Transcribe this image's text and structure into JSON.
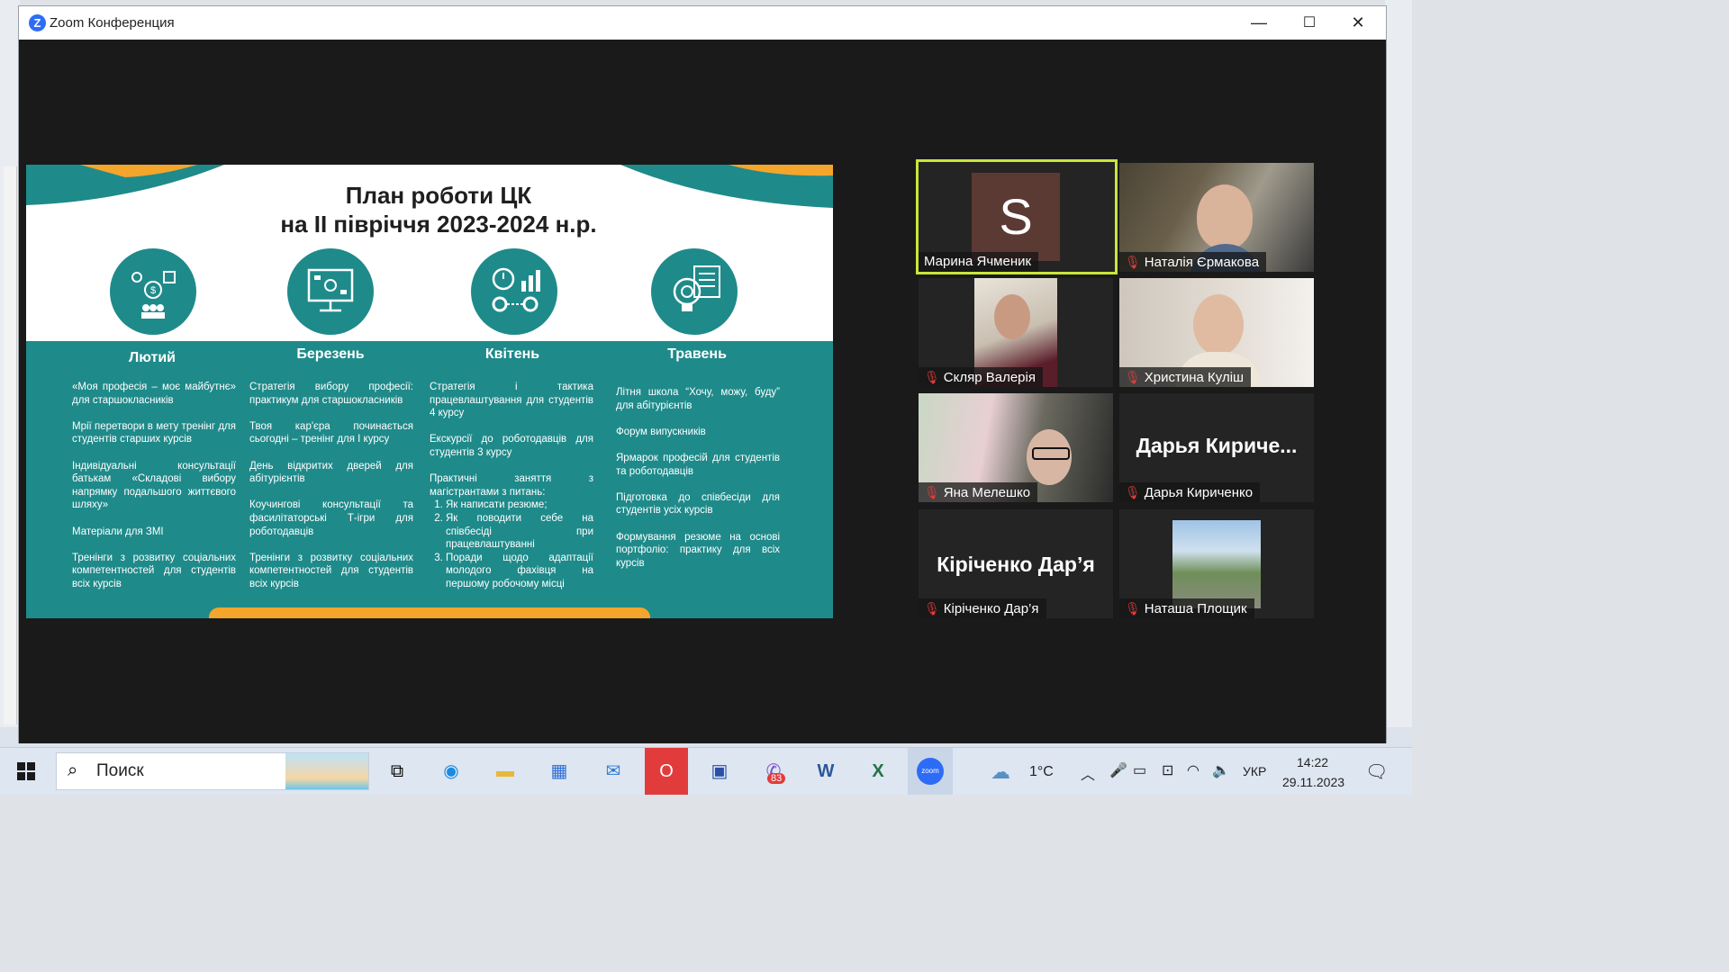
{
  "window": {
    "title": "Zoom Конференция",
    "minimize": "—",
    "maximize": "☐",
    "close": "✕"
  },
  "slide": {
    "title_line1": "План роботи ЦК",
    "title_line2": "на ІІ півріччя 2023-2024 н.р.",
    "columns": [
      {
        "month": "Лютий",
        "items": [
          "«Моя професія – моє майбутнє» для старшокласників",
          "Мрії перетвори в мету тренінг для студентів старших курсів",
          "Індивідуальні консультації батькам «Складові вибору напрямку подальшого життєвого шляху»",
          "Матеріали для ЗМІ",
          "Тренінги з розвитку соціальних компетентностей для студентів всіх курсів"
        ]
      },
      {
        "month": "Березень",
        "items": [
          "Стратегія вибору професії: практикум для старшокласників",
          "Твоя кар'єра починається сьогодні – тренінг для І курсу",
          "День відкритих дверей для абітурієнтів",
          "Коучингові консультації та фасилітаторські Т-ігри для роботодавців",
          "Тренінги з розвитку соціальних компетентностей для студентів всіх курсів"
        ]
      },
      {
        "month": "Квітень",
        "items": [
          "Стратегія і тактика працевлаштування для студентів 4 курсу",
          "Екскурсії до роботодавців для студентів 3 курсу",
          "Практичні заняття з магістрантами з питань:"
        ],
        "sublist": [
          "Як написати резюме;",
          "Як поводити себе на співбесіді при працевлаштуванні",
          "Поради щодо адаптації молодого фахівця на першому робочому місці"
        ]
      },
      {
        "month": "Травень",
        "items": [
          "Літня школа “Хочу, можу, буду” для абітурієнтів",
          "Форум випускників",
          "Ярмарок професій для студентів та роботодавців",
          "Підготовка до співбесіди для студентів усіх курсів",
          "Формування резюме на основі портфоліо: практику для всіх курсів"
        ]
      }
    ]
  },
  "participants": [
    {
      "name": "Марина Ячменик",
      "muted": false,
      "avatar_letter": "S"
    },
    {
      "name": "Наталія Єрмакова",
      "muted": true
    },
    {
      "name": "Скляр Валерія",
      "muted": true
    },
    {
      "name": "Христина Куліш",
      "muted": true
    },
    {
      "name": "Яна Мелешко",
      "muted": true
    },
    {
      "name": "Дарья Кириченко",
      "muted": true,
      "display_text": "Дарья Кириче..."
    },
    {
      "name": "Кіріченко Дар’я",
      "muted": true,
      "display_text": "Кіріченко Дар’я"
    },
    {
      "name": "Наташа Площик",
      "muted": true
    }
  ],
  "taskbar": {
    "search_placeholder": "Поиск",
    "weather": "1°C",
    "language": "УКР",
    "time": "14:22",
    "date": "29.11.2023",
    "viber_badge": "83"
  },
  "colors": {
    "teal": "#1f8a8a",
    "orange": "#f4a52b",
    "active_border": "#c9e63a",
    "mute": "#e03c3c"
  }
}
